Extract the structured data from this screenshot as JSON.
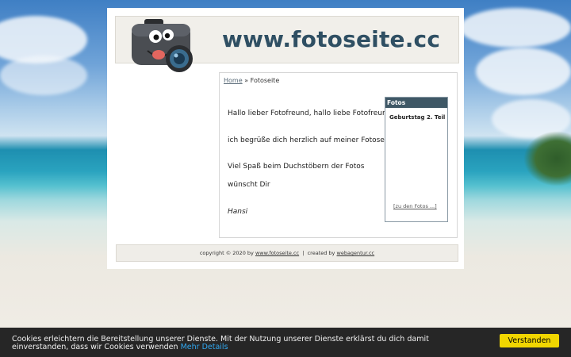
{
  "header": {
    "site_title": "www.fotoseite.cc"
  },
  "breadcrumb": {
    "home": "Home",
    "separator": "»",
    "current": "Fotoseite"
  },
  "main": {
    "paragraphs": [
      "Hallo lieber Fotofreund, hallo liebe Fotofreundin,",
      "ich begrüße dich herzlich auf meiner Fotoseite.",
      "Viel Spaß beim Duchstöbern der Fotos",
      "wünscht Dir",
      "Hansi"
    ]
  },
  "sidebar": {
    "title": "Fotos",
    "album_title": "Geburtstag 2. Teil",
    "album_link": "[zu den Fotos ...]"
  },
  "footer": {
    "copyright": "copyright © 2020 by",
    "site_link": "www.fotoseite.cc",
    "separator": "|",
    "created_by": "created by",
    "agency_link": "webagentur.cc"
  },
  "cookie": {
    "text": "Cookies erleichtern die Bereitstellung unserer Dienste. Mit der Nutzung unserer Dienste erklärst du dich damit einverstanden, dass wir Cookies verwenden",
    "more_link": "Mehr Details",
    "accept_button": "Verstanden"
  },
  "colors": {
    "title": "#2f4f63",
    "sidebox_header": "#3f5866",
    "cookie_bg": "#262626",
    "cookie_button": "#f1d600",
    "cookie_link": "#31a8f0"
  }
}
